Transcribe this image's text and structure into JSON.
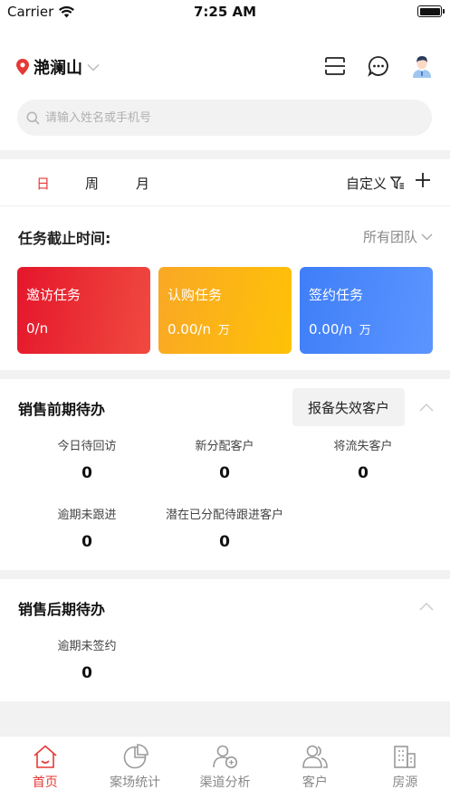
{
  "status_bar": {
    "carrier": "Carrier",
    "time": "7:25 AM"
  },
  "header": {
    "location": "滟澜山"
  },
  "search": {
    "placeholder": "请输入姓名或手机号"
  },
  "period_tabs": [
    {
      "label": "日",
      "active": true
    },
    {
      "label": "周",
      "active": false
    },
    {
      "label": "月",
      "active": false
    }
  ],
  "custom_label": "自定义",
  "deadline": {
    "label": "任务截止时间:",
    "team": "所有团队"
  },
  "task_cards": [
    {
      "title": "邀访任务",
      "value": "0/n",
      "unit": "",
      "color": "#e5162b"
    },
    {
      "title": "认购任务",
      "value": "0.00/n",
      "unit": "万",
      "color": "#f9a825"
    },
    {
      "title": "签约任务",
      "value": "0.00/n",
      "unit": "万",
      "color": "#3f7ef8"
    }
  ],
  "pre_sales": {
    "title": "销售前期待办",
    "report_button": "报备失效客户",
    "stats": [
      {
        "label": "今日待回访",
        "value": "0"
      },
      {
        "label": "新分配客户",
        "value": "0"
      },
      {
        "label": "将流失客户",
        "value": "0"
      },
      {
        "label": "逾期未跟进",
        "value": "0"
      },
      {
        "label": "潜在已分配待跟进客户",
        "value": "0"
      }
    ]
  },
  "post_sales": {
    "title": "销售后期待办",
    "stats": [
      {
        "label": "逾期未签约",
        "value": "0"
      }
    ]
  },
  "tabbar": [
    {
      "label": "首页",
      "icon": "home-icon",
      "active": true
    },
    {
      "label": "案场统计",
      "icon": "pie-chart-icon",
      "active": false
    },
    {
      "label": "渠道分析",
      "icon": "channel-user-icon",
      "active": false
    },
    {
      "label": "客户",
      "icon": "customers-icon",
      "active": false
    },
    {
      "label": "房源",
      "icon": "building-icon",
      "active": false
    }
  ],
  "colors": {
    "accent": "#e53935",
    "separator": "#f2f2f2"
  }
}
